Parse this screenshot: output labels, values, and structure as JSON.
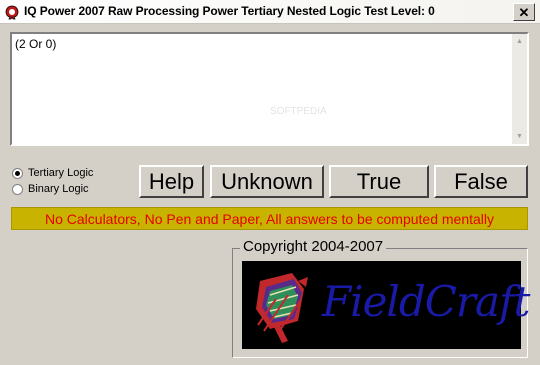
{
  "window": {
    "title": "IQ Power 2007 Raw Processing Power Tertiary Nested Logic Test Level: 0",
    "close_label": "✕"
  },
  "output": {
    "text": "(2 Or 0)",
    "watermark": "SOFTPEDIA"
  },
  "logic_mode": {
    "options": [
      {
        "label": "Tertiary Logic",
        "checked": true
      },
      {
        "label": "Binary Logic",
        "checked": false
      }
    ]
  },
  "buttons": {
    "help": "Help",
    "unknown": "Unknown",
    "true": "True",
    "false": "False"
  },
  "notice": "No Calculators, No Pen and Paper, All answers to be computed mentally",
  "copyright": "Copyright 2004-2007",
  "logo": {
    "text": "FieldCraft",
    "colors": {
      "text": "#1a1aa8",
      "background": "#000000",
      "emblem_red": "#c0282c",
      "emblem_green": "#2f8f5b",
      "emblem_purple": "#5a2a8a"
    }
  },
  "colors": {
    "window_bg": "#d4d0c8",
    "notice_bg": "#c8b400",
    "notice_text": "#e40000"
  }
}
